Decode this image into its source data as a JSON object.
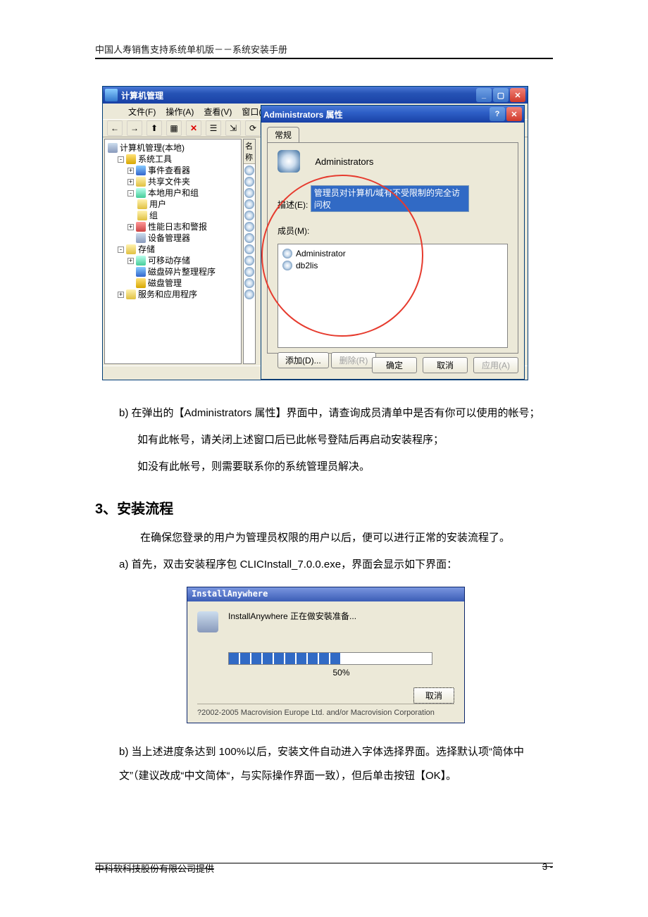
{
  "header": {
    "title": "中国人寿销售支持系统单机版－－系统安装手册"
  },
  "shot1": {
    "window_title": "计算机管理",
    "menu": {
      "file": "文件(F)",
      "action": "操作(A)",
      "view": "查看(V)",
      "window": "窗口("
    },
    "toolbar": {
      "back": "←",
      "fwd": "→",
      "up": "⬆",
      "list": "▦",
      "delete": "✕",
      "prop": "☰",
      "export": "⇲",
      "refresh": "⟳"
    },
    "tree": {
      "root": "计算机管理(本地)",
      "systools": "系统工具",
      "eventview": "事件查看器",
      "shared": "共享文件夹",
      "localusers": "本地用户和组",
      "users": "用户",
      "groups": "组",
      "perflog": "性能日志和警报",
      "devmgr": "设备管理器",
      "storage": "存储",
      "removable": "可移动存储",
      "defrag": "磁盘碎片整理程序",
      "diskmgmt": "磁盘管理",
      "services": "服务和应用程序"
    },
    "listheader": "名称"
  },
  "propdlg": {
    "title": "Administrators 属性",
    "tab": "常规",
    "groupname": "Administrators",
    "desc_label": "描述(E):",
    "desc_value": "管理员对计算机/域有不受限制的完全访问权",
    "members_label": "成员(M):",
    "members": {
      "m1": "Administrator",
      "m2": "db2lis"
    },
    "add": "添加(D)...",
    "remove": "删除(R)",
    "ok": "确定",
    "cancel": "取消",
    "apply": "应用(A)"
  },
  "para": {
    "b_intro": "b)  在弹出的【Administrators 属性】界面中，请查询成员清单中是否有你可以使用的帐号；",
    "b_has": "如有此帐号，请关闭上述窗口后已此帐号登陆后再启动安装程序；",
    "b_not": "如没有此帐号，则需要联系你的系统管理员解决。",
    "h2": "3、安装流程",
    "intro3": "在确保您登录的用户为管理员权限的用户以后，便可以进行正常的安装流程了。",
    "a": "a)  首先，双击安装程序包 CLICInstall_7.0.0.exe，界面会显示如下界面：",
    "b2": "b)  当上述进度条达到 100%以后，安装文件自动进入字体选择界面。选择默认项“简体中文”（建议改成“中文简体“，与实际操作界面一致），但后单击按钮【OK】。"
  },
  "shot2": {
    "title": "InstallAnywhere",
    "status": "InstallAnywhere 正在做安裝准备...",
    "percent": "50%",
    "cancel": "取消",
    "copyright": "?2002-2005 Macrovision Europe Ltd. and/or Macrovision Corporation"
  },
  "footer": {
    "left": "中科软科技股份有限公司提供",
    "right": "3 -"
  }
}
